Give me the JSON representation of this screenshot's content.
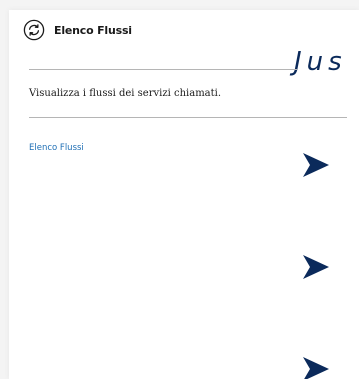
{
  "header": {
    "title": "Elenco Flussi",
    "icon": "refresh-cycle-icon"
  },
  "decorative_text": "Jus",
  "description": "Visualizza i flussi dei servizi chiamati.",
  "link": {
    "label": "Elenco Flussi"
  },
  "arrows": {
    "icon": "send-arrow-icon",
    "count": 3
  },
  "colors": {
    "navy": "#0b2a5b",
    "link": "#1f6fb5",
    "divider": "#b5b5b5"
  }
}
